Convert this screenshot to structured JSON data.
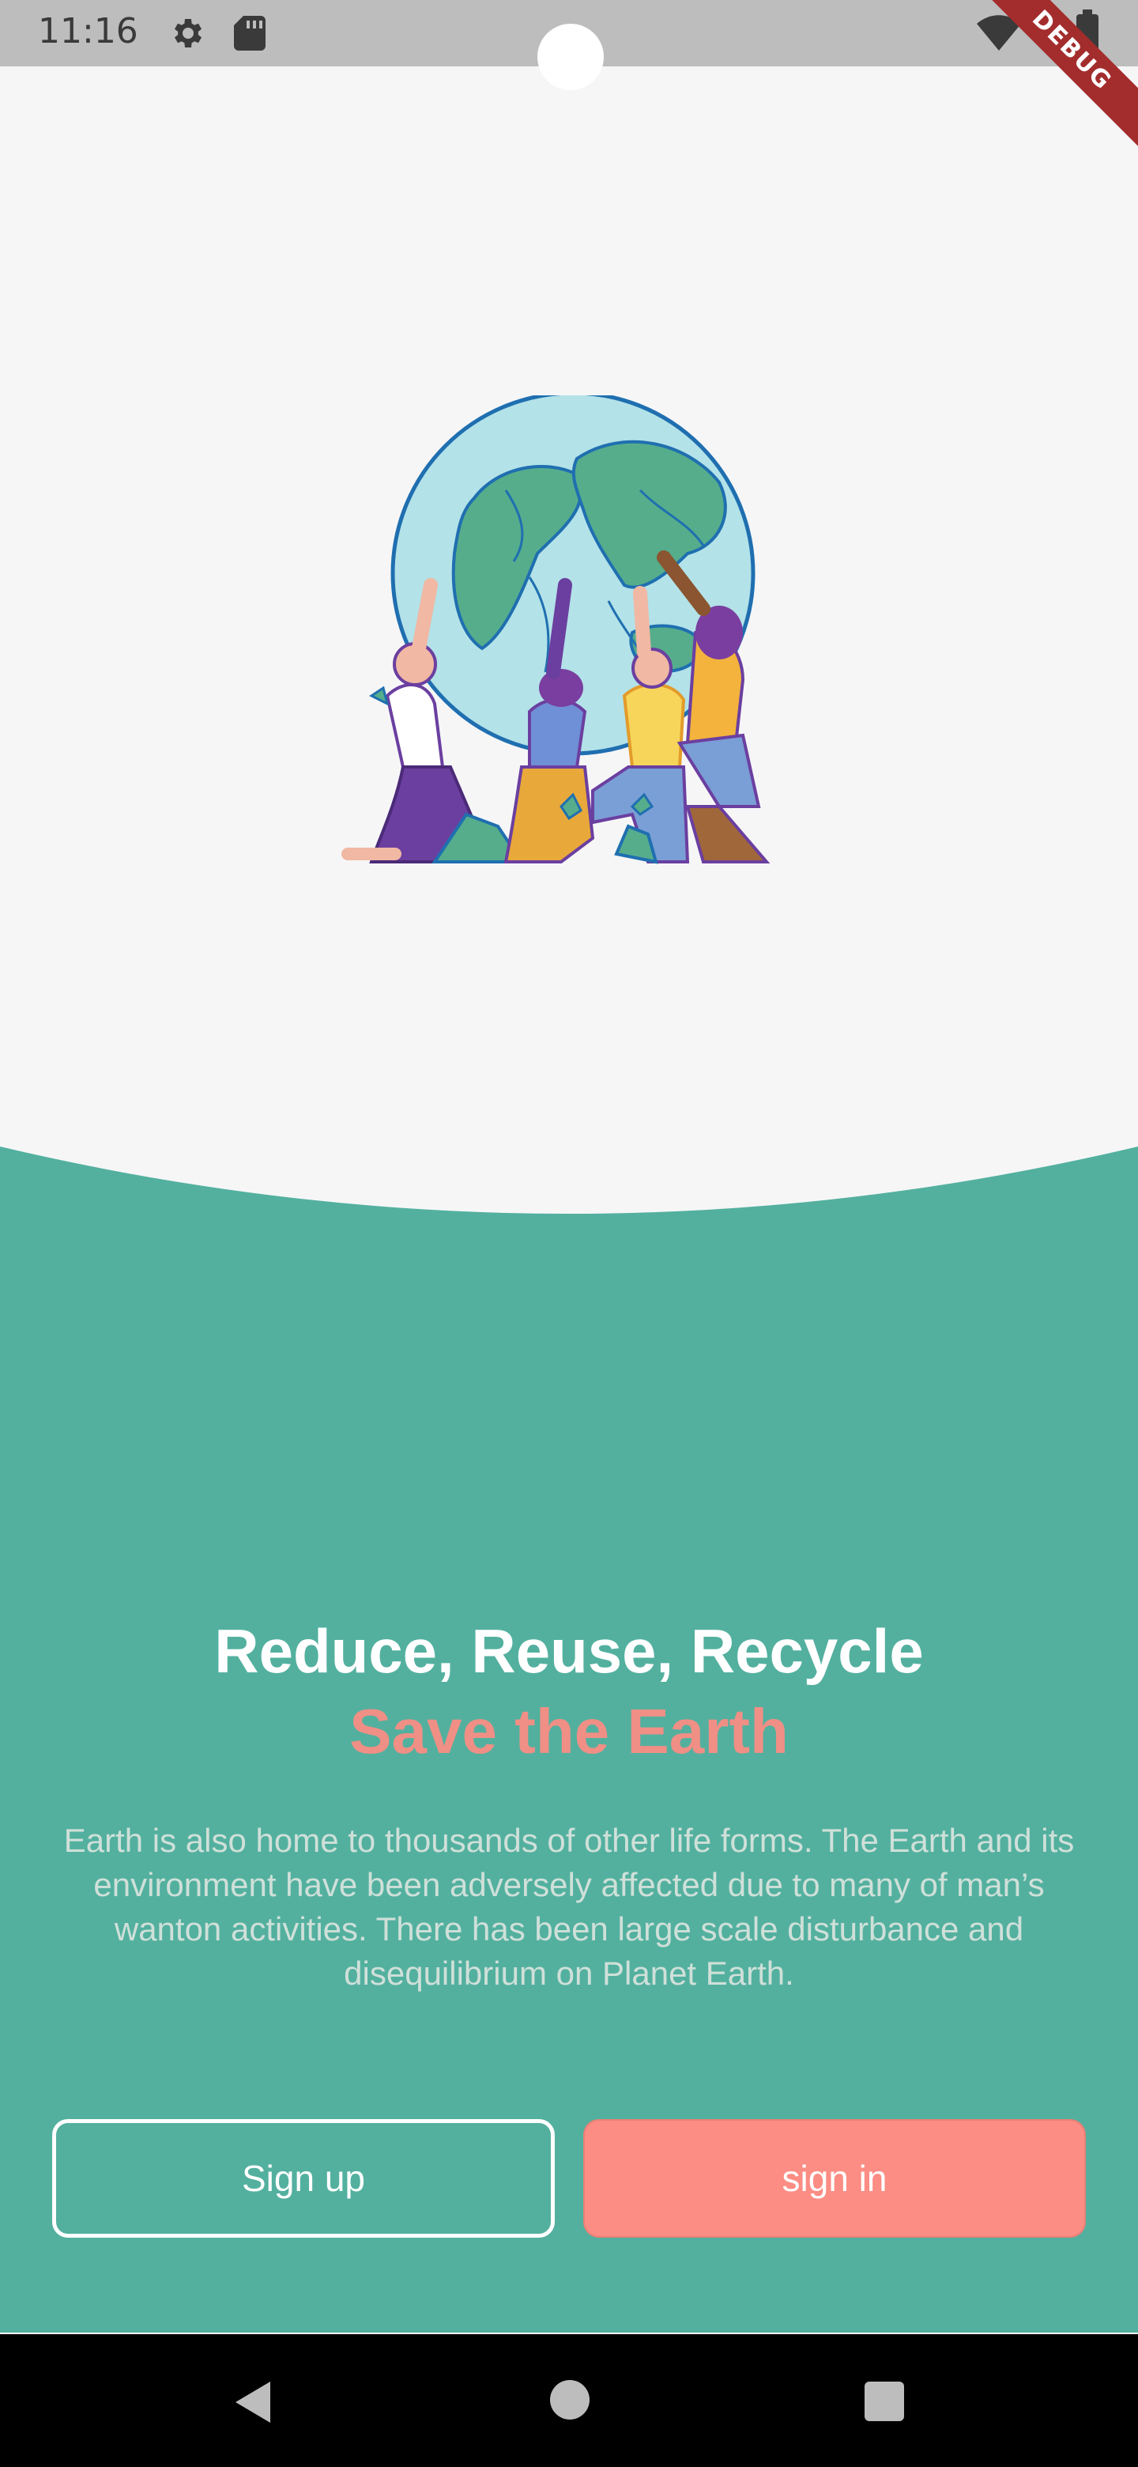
{
  "status_bar": {
    "time": "11:16",
    "icons": [
      "gear-icon",
      "sd-card-icon",
      "wifi-icon",
      "battery-icon"
    ]
  },
  "debug_banner": "DEBUG",
  "hero": {
    "title": "Reduce, Reuse, Recycle",
    "subtitle": "Save the Earth",
    "description": "Earth is also home to thousands of other life forms. The Earth and its environment have been adversely affected due to many of man’s wanton activities. There has been large scale disturbance and disequilibrium on Planet Earth."
  },
  "actions": {
    "sign_up_label": "Sign up",
    "sign_in_label": "sign in"
  },
  "nav_bar": {
    "icons": [
      "back-icon",
      "home-icon",
      "recent-apps-icon"
    ]
  },
  "colors": {
    "panel_green": "#53b09f",
    "accent_coral": "#fb8d84",
    "background": "#f6f6f7",
    "status_bar": "#bdbdbd"
  }
}
